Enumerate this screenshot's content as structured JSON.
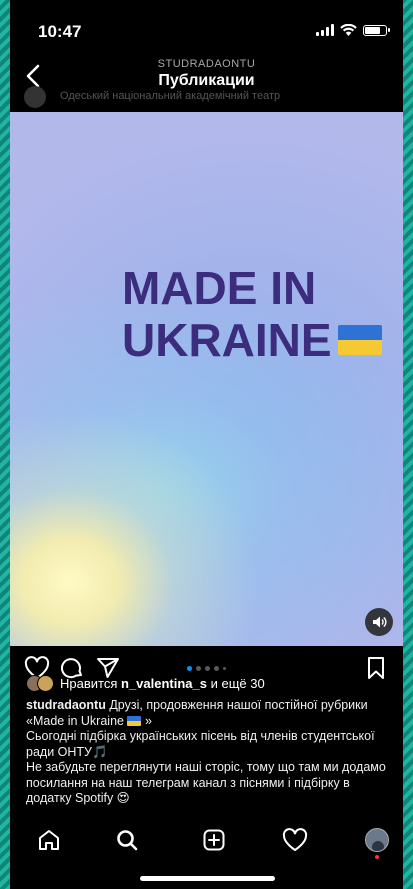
{
  "status_bar": {
    "time": "10:47"
  },
  "header": {
    "account": "STUDRADAONTU",
    "title": "Публикации"
  },
  "previous_post_caption": "Одеський національний академічний театр",
  "post": {
    "image_text": {
      "line1": "MADE IN",
      "line2": "UKRAINE"
    },
    "carousel": {
      "total": 5,
      "active_index": 0
    },
    "likes": {
      "prefix": "Нравится",
      "user": "n_valentina_s",
      "suffix": "и ещё 30"
    },
    "caption": {
      "username": "studradaontu",
      "line1": "Друзі, продовження нашої постійної рубрики «Made in Ukraine",
      "line1_end": "»",
      "line2": "Сьогодні підбірка українських пісень від членів студентської ради ОНТУ🎵",
      "line3": "Не забудьте переглянути наші сторіс, тому що там ми додамо посилання на наш телеграм канал з піснями і підбірку в додатку Spotify 😍"
    }
  },
  "icons": {
    "back": "chevron-left-icon",
    "like": "heart-icon",
    "comment": "comment-icon",
    "share": "paper-plane-icon",
    "save": "bookmark-icon",
    "sound": "speaker-icon",
    "tabs": [
      "home-icon",
      "search-icon",
      "add-post-icon",
      "activity-heart-icon",
      "profile-avatar"
    ]
  },
  "colors": {
    "headline": "#3b2c7d",
    "image_background": "#b3b8eb",
    "carousel_active": "#0095f6",
    "notification_dot": "#ff3040"
  }
}
